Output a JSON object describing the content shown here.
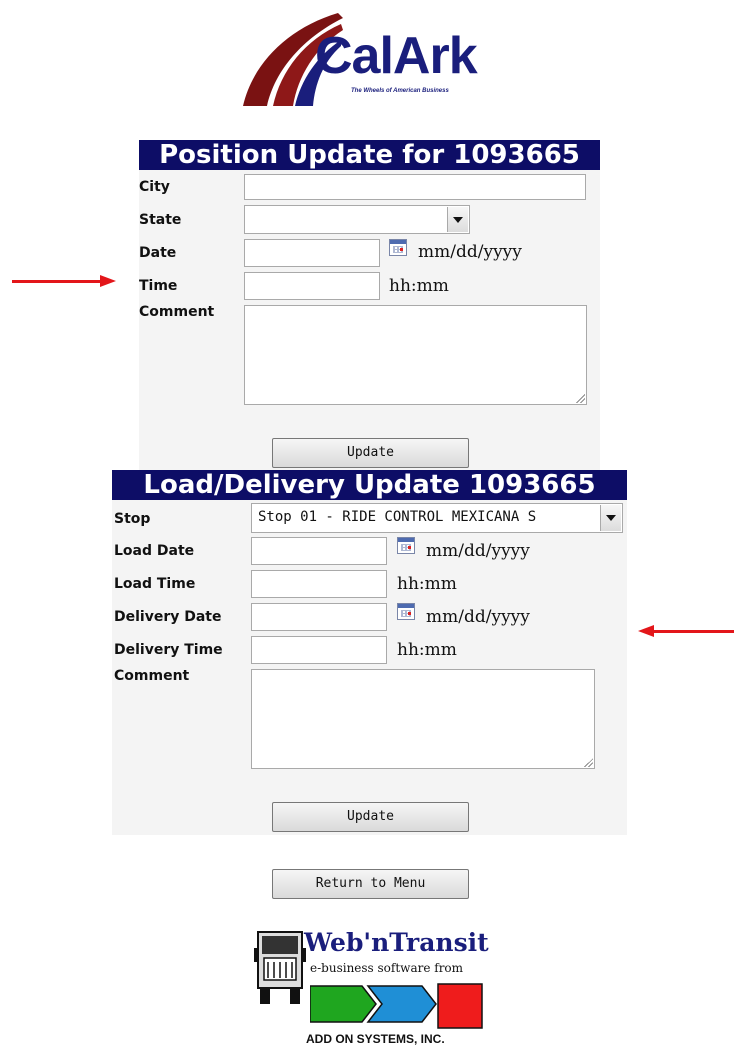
{
  "header": {
    "logo_text": "CalArk",
    "tagline": "The Wheels of American Business"
  },
  "position_update": {
    "title": "Position Update for 1093665",
    "city_label": "City",
    "city_value": "",
    "state_label": "State",
    "state_value": "",
    "date_label": "Date",
    "date_value": "",
    "date_format": "mm/dd/yyyy",
    "time_label": "Time",
    "time_value": "",
    "time_format": "hh:mm",
    "comment_label": "Comment",
    "comment_value": "",
    "update_button": "Update"
  },
  "load_delivery_update": {
    "title": "Load/Delivery Update 1093665",
    "stop_label": "Stop",
    "stop_value": "Stop 01 - RIDE CONTROL MEXICANA S",
    "load_date_label": "Load Date",
    "load_date_value": "",
    "load_date_format": "mm/dd/yyyy",
    "load_time_label": "Load Time",
    "load_time_value": "",
    "load_time_format": "hh:mm",
    "delivery_date_label": "Delivery Date",
    "delivery_date_value": "",
    "delivery_date_format": "mm/dd/yyyy",
    "delivery_time_label": "Delivery Time",
    "delivery_time_value": "",
    "delivery_time_format": "hh:mm",
    "comment_label": "Comment",
    "comment_value": "",
    "update_button": "Update"
  },
  "return_button": "Return to Menu",
  "footer": {
    "product_name": "Web'nTransit",
    "subtitle": "e-business software from",
    "company": "ADD ON SYSTEMS, INC."
  },
  "colors": {
    "title_bar": "#0d0d66",
    "brand_navy": "#1a1e7c",
    "annotation_arrow": "#e3161a",
    "panel_bg": "#f4f4f4"
  },
  "icons": [
    "calendar-icon",
    "chevron-down-icon",
    "truck-icon",
    "annotation-arrow"
  ]
}
